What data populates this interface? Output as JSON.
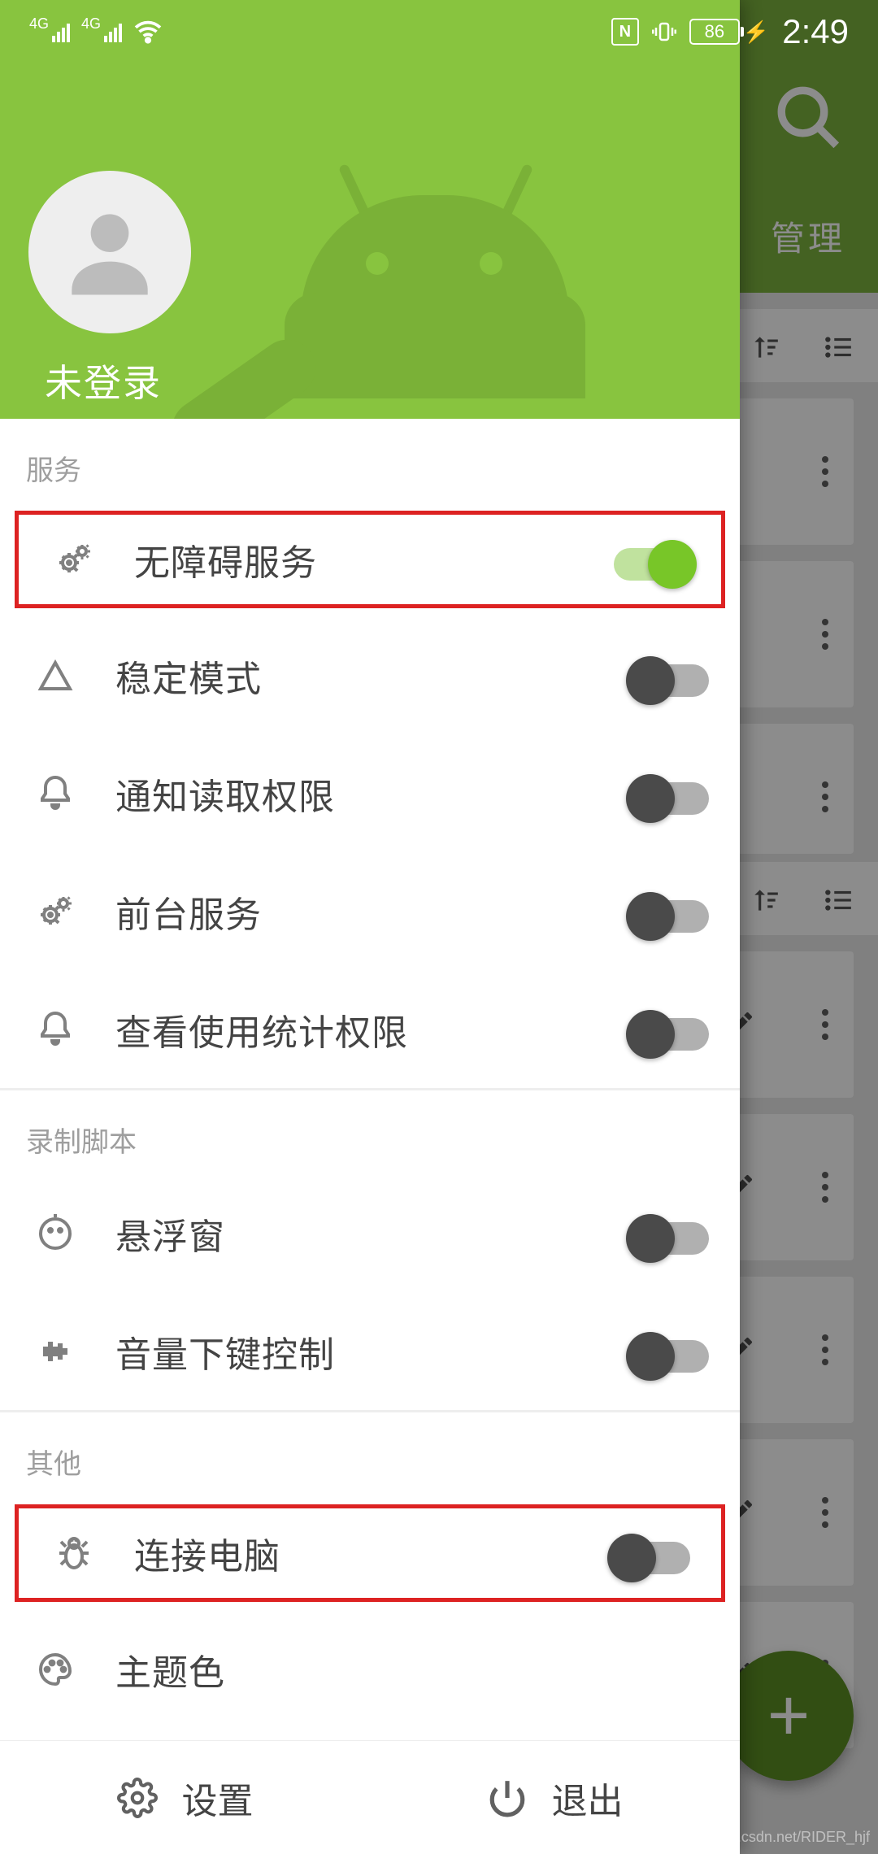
{
  "status_bar": {
    "network_label": "4G",
    "nfc_label": "N",
    "battery_percent": "86",
    "time": "2:49"
  },
  "background": {
    "tab_manage": "管理",
    "fab_label": "+"
  },
  "drawer": {
    "login_label": "未登录",
    "sections": [
      {
        "title": "服务",
        "items": [
          {
            "icon": "gears",
            "label": "无障碍服务",
            "toggle": true,
            "highlight": true
          },
          {
            "icon": "triangle",
            "label": "稳定模式",
            "toggle": false
          },
          {
            "icon": "bell",
            "label": "通知读取权限",
            "toggle": false
          },
          {
            "icon": "gears",
            "label": "前台服务",
            "toggle": false
          },
          {
            "icon": "bell",
            "label": "查看使用统计权限",
            "toggle": false
          }
        ]
      },
      {
        "title": "录制脚本",
        "items": [
          {
            "icon": "face",
            "label": "悬浮窗",
            "toggle": false
          },
          {
            "icon": "pulse",
            "label": "音量下键控制",
            "toggle": false
          }
        ]
      },
      {
        "title": "其他",
        "items": [
          {
            "icon": "bug",
            "label": "连接电脑",
            "toggle": false,
            "highlight": true
          },
          {
            "icon": "palette",
            "label": "主题色",
            "toggle": null
          }
        ]
      }
    ],
    "footer": {
      "settings_label": "设置",
      "exit_label": "退出"
    }
  },
  "watermark": "blog.csdn.net/RIDER_hjf"
}
